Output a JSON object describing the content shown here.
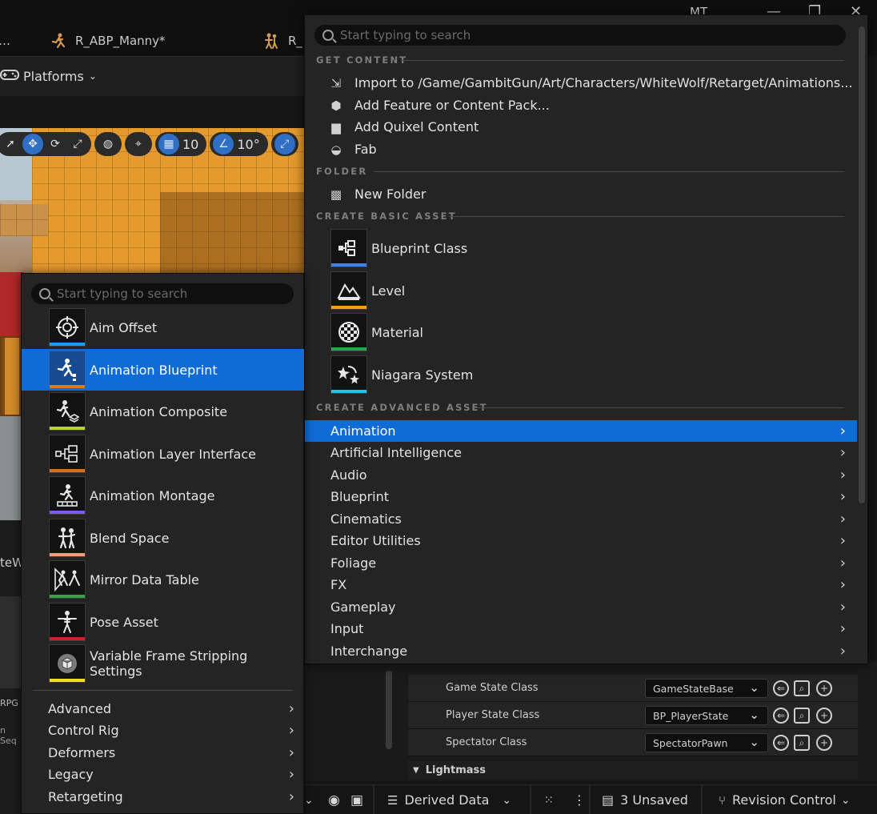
{
  "editor": {
    "tabs": [
      {
        "label": "R_ABP_Manny*"
      },
      {
        "label": "R_"
      }
    ],
    "window_user_initials": "MT",
    "toolbar": {
      "platforms_label": "Platforms"
    },
    "viewport_toolbar": {
      "grid_snap_value": "10",
      "rotation_snap_value": "10°"
    },
    "left_fragments": {
      "tab_fragment": "teW",
      "label_rpg": "RPG",
      "label_seq": "n Seq"
    }
  },
  "add_menu": {
    "search_placeholder": "Start typing to search",
    "sections": {
      "get_content": "GET CONTENT",
      "folder": "FOLDER",
      "create_basic_asset": "CREATE BASIC ASSET",
      "create_advanced_asset": "CREATE ADVANCED ASSET"
    },
    "get_content_items": [
      {
        "label": "Import to /Game/GambitGun/Art/Characters/WhiteWolf/Retarget/Animations...",
        "icon": "import-icon"
      },
      {
        "label": "Add Feature or Content Pack...",
        "icon": "feature-pack-icon"
      },
      {
        "label": "Add Quixel Content",
        "icon": "quixel-icon"
      },
      {
        "label": "Fab",
        "icon": "fab-icon"
      }
    ],
    "folder_items": [
      {
        "label": "New Folder",
        "icon": "new-folder-icon"
      }
    ],
    "basic_assets": [
      {
        "label": "Blueprint Class",
        "icon": "blueprint-class-icon",
        "color": "#3b82f6"
      },
      {
        "label": "Level",
        "icon": "level-icon",
        "color": "#f59e0b"
      },
      {
        "label": "Material",
        "icon": "material-icon",
        "color": "#22a84a"
      },
      {
        "label": "Niagara System",
        "icon": "niagara-icon",
        "color": "#22c2f0"
      }
    ],
    "advanced_categories": [
      {
        "label": "Animation",
        "selected": true
      },
      {
        "label": "Artificial Intelligence"
      },
      {
        "label": "Audio"
      },
      {
        "label": "Blueprint"
      },
      {
        "label": "Cinematics"
      },
      {
        "label": "Editor Utilities"
      },
      {
        "label": "Foliage"
      },
      {
        "label": "FX"
      },
      {
        "label": "Gameplay"
      },
      {
        "label": "Input"
      },
      {
        "label": "Interchange"
      }
    ]
  },
  "animation_submenu": {
    "search_placeholder": "Start typing to search",
    "items": [
      {
        "label": "Aim Offset",
        "icon": "aim-offset-icon",
        "color": "#1aa0e8"
      },
      {
        "label": "Animation Blueprint",
        "icon": "animation-blueprint-icon",
        "color": "#e07b1a",
        "selected": true
      },
      {
        "label": "Animation Composite",
        "icon": "animation-composite-icon",
        "color": "#b8d62a"
      },
      {
        "label": "Animation Layer Interface",
        "icon": "animation-layer-interface-icon",
        "color": "#d4731a"
      },
      {
        "label": "Animation Montage",
        "icon": "animation-montage-icon",
        "color": "#7b5cf0"
      },
      {
        "label": "Blend Space",
        "icon": "blend-space-icon",
        "color": "#f0a07a"
      },
      {
        "label": "Mirror Data Table",
        "icon": "mirror-data-table-icon",
        "color": "#3aa048"
      },
      {
        "label": "Pose Asset",
        "icon": "pose-asset-icon",
        "color": "#d02030"
      },
      {
        "label": "Variable Frame Stripping Settings",
        "icon": "variable-frame-stripping-icon",
        "color": "#f0e020"
      }
    ],
    "categories": [
      {
        "label": "Advanced"
      },
      {
        "label": "Control Rig"
      },
      {
        "label": "Deformers"
      },
      {
        "label": "Legacy"
      },
      {
        "label": "Retargeting"
      }
    ]
  },
  "details": {
    "rows": [
      {
        "label": "Game State Class",
        "value": "GameStateBase"
      },
      {
        "label": "Player State Class",
        "value": "BP_PlayerState"
      },
      {
        "label": "Spectator Class",
        "value": "SpectatorPawn"
      }
    ],
    "section_lightmass": "Lightmass"
  },
  "status_bar": {
    "derived_data": "Derived Data",
    "unsaved": "3 Unsaved",
    "revision_control": "Revision Control"
  },
  "colors": {
    "accent": "#0f6bd6",
    "panel": "#242424",
    "background": "#151515"
  }
}
